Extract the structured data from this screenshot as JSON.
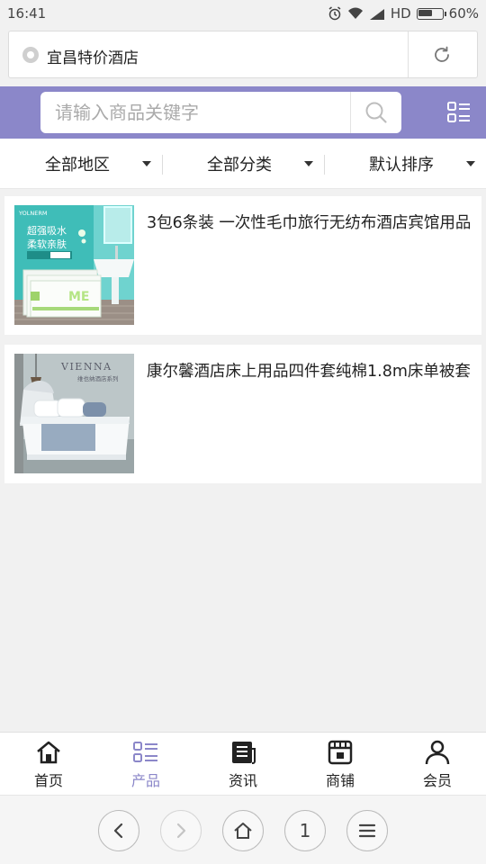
{
  "status_bar": {
    "time": "16:41",
    "network": "HD",
    "battery": "60%",
    "battery_level": 0.6
  },
  "browser": {
    "page_title": "宜昌特价酒店",
    "tab_count": "1"
  },
  "search": {
    "placeholder": "请输入商品关键字"
  },
  "filters": [
    {
      "label": "全部地区"
    },
    {
      "label": "全部分类"
    },
    {
      "label": "默认排序"
    }
  ],
  "products": [
    {
      "name": "3包6条装 一次性毛巾旅行无纺布酒店宾馆用品",
      "image_text": [
        "YOLNERM",
        "超强吸水",
        "柔软亲肤",
        "ME"
      ]
    },
    {
      "name": "康尔馨酒店床上用品四件套纯棉1.8m床单被套",
      "image_text": [
        "VIENNA",
        "维也纳酒店系列"
      ]
    }
  ],
  "bottom_nav": [
    {
      "label": "首页",
      "icon": "home-icon"
    },
    {
      "label": "产品",
      "icon": "list-icon",
      "active": true
    },
    {
      "label": "资讯",
      "icon": "news-icon"
    },
    {
      "label": "商铺",
      "icon": "store-icon"
    },
    {
      "label": "会员",
      "icon": "user-icon"
    }
  ],
  "colors": {
    "accent": "#8b87c9",
    "background": "#f1f1f1"
  }
}
